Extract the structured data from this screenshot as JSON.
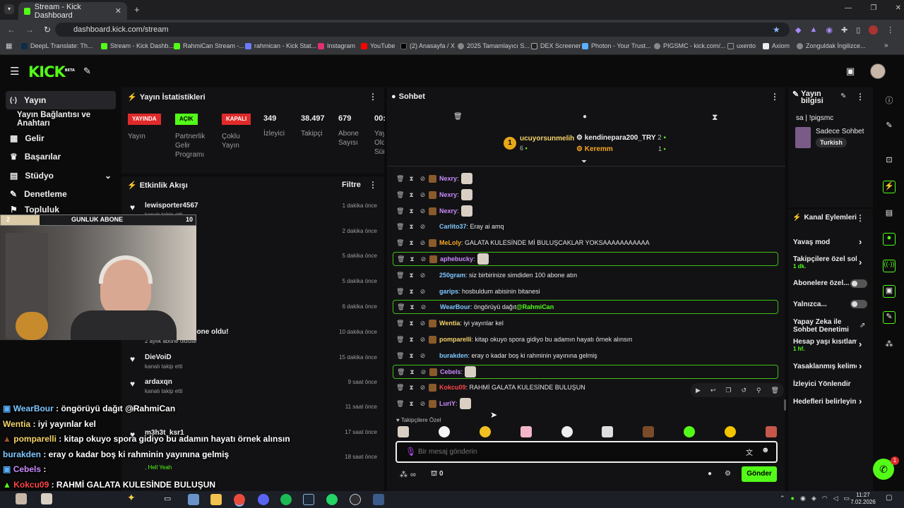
{
  "browser": {
    "tab_title": "Stream - Kick Dashboard",
    "url": "dashboard.kick.com/stream",
    "bookmarks": [
      "DeepL Translate: Th...",
      "Stream - Kick Dashb...",
      "RahmiCan Stream -...",
      "rahmican - Kick Stat...",
      "Instagram",
      "YouTube",
      "(2) Anasayfa / X",
      "2025 Tamamlayıcı S...",
      "DEX Screener",
      "Photon - Your Trust...",
      "PIGSMC - kick.com/...",
      "uxento",
      "Axiom",
      "Zonguldak İngilizce..."
    ]
  },
  "brand": {
    "logo": "KICK",
    "beta": "BETA",
    "accent": "#53fc18"
  },
  "nav": {
    "items": [
      "Yayın",
      "Yayın Bağlantısı ve Anahtarı",
      "Gelir",
      "Başarılar",
      "Stüdyo",
      "Denetleme",
      "Topluluk"
    ]
  },
  "stats": {
    "title": "Yayın İstatistikleri",
    "live_badge": "YAYINDA",
    "live_label": "Yayın",
    "partner_badge": "AÇIK",
    "partner_label": [
      "Partnerlik",
      "Gelir",
      "Programı"
    ],
    "multi_badge": "KAPALI",
    "multi_label": [
      "Çoklu",
      "Yayın"
    ],
    "viewers": "349",
    "viewers_label": "İzleyici",
    "followers": "38.497",
    "followers_label": "Takipçi",
    "subs": "679",
    "subs_label": [
      "Abone",
      "Sayısı"
    ],
    "uptime": "00:",
    "uptime_label": [
      "Yay",
      "Old",
      "Sür"
    ]
  },
  "activity": {
    "title": "Etkinlik Akışı",
    "filter": "Filtre",
    "items": [
      {
        "name": "lewisporter4567",
        "sub": "kanalı takip etti",
        "time": "1 dakika önce"
      },
      {
        "name": "",
        "sub": "",
        "time": "2 dakika önce"
      },
      {
        "name": "",
        "sub": "",
        "time": "5 dakika önce"
      },
      {
        "name": "",
        "sub": "",
        "time": "5 dakika önce"
      },
      {
        "name": "",
        "sub": "",
        "time": "6 dakika önce"
      },
      {
        "name": "n abone oldu!",
        "sub": "2 aylık abone oldular",
        "time": "10 dakika önce"
      },
      {
        "name": "DieVoiD",
        "sub": "kanalı takip etti",
        "time": "15 dakika önce"
      },
      {
        "name": "ardaxqn",
        "sub": "kanalı takip etti",
        "time": "9 saat önce"
      },
      {
        "name": "",
        "sub": "",
        "time": "11 saat önce"
      },
      {
        "name": "m3h3t_ksr1",
        "sub": "",
        "time": "17 saat önce"
      },
      {
        "name": "",
        "sub": ", Hell Yeah",
        "time": "18 saat önce"
      }
    ]
  },
  "overlay": {
    "goal_label": "GUNLUK ABONE",
    "goal_current": "2",
    "goal_target": "10",
    "goal_progress": 0.2,
    "chat": [
      {
        "user": "WearBour",
        "msg": " : öngörüyü dağıt @RahmiCan",
        "color": "#7ec8ff"
      },
      {
        "user": "Wentia",
        "msg": " : iyi yayınlar kel",
        "color": "#f5d36b"
      },
      {
        "user": "pomparelli",
        "msg": " : kitap okuyo spora gidiyo bu adamın hayatı örnek alınsın",
        "color": "#f5d36b"
      },
      {
        "user": "burakden",
        "msg": " : eray o kadar boş ki rahminin yayınına gelmiş",
        "color": "#7ec8ff"
      },
      {
        "user": "Cebels",
        "msg": " :",
        "color": "#c98bff"
      },
      {
        "user": "Kokcu09",
        "msg": " : RAHMİ GALATA KULESİNDE BULUŞUN",
        "color": "#ff4646"
      }
    ]
  },
  "chat": {
    "title": "Sohbet",
    "top_gifters": [
      {
        "name": "ucuyorsunmelih",
        "count": "6"
      },
      {
        "name": "kendinepara200_TRY",
        "count": "2"
      },
      {
        "name": "Keremm",
        "count": "1"
      }
    ],
    "rank": "1",
    "messages": [
      {
        "user": "Nexry",
        "msg": ":",
        "color": "#c98bff",
        "emote": true,
        "hl": false
      },
      {
        "user": "Nexry",
        "msg": ":",
        "color": "#c98bff",
        "emote": true,
        "hl": false
      },
      {
        "user": "Nexry",
        "msg": ":",
        "color": "#c98bff",
        "emote": true,
        "hl": false
      },
      {
        "user": "Carlito37",
        "msg": ": Eray ai amq",
        "color": "#7ec8ff",
        "emote": false,
        "hl": false
      },
      {
        "user": "MeLoly",
        "msg": ": GALATA KULESİNDE Mİ BULUŞCAKLAR YOKSAAAAAAAAAAA",
        "color": "#f5a623",
        "emote": false,
        "hl": false
      },
      {
        "user": "aphebucky",
        "msg": ":",
        "color": "#c98bff",
        "emote": true,
        "hl": true
      },
      {
        "user": "250gram",
        "msg": ": siz birbirinize simdiden 100 abone atın",
        "color": "#7ec8ff",
        "emote": false,
        "hl": false
      },
      {
        "user": "garips",
        "msg": ": hosbuldum abisinin bitanesi",
        "color": "#7ec8ff",
        "emote": false,
        "hl": false
      },
      {
        "user": "WearBour",
        "msg": ": öngörüyü dağıt ",
        "mention": "@RahmiCan",
        "color": "#7ec8ff",
        "emote": false,
        "hl": true
      },
      {
        "user": "Wentia",
        "msg": ": iyi yayınlar kel",
        "color": "#f5d36b",
        "emote": false,
        "hl": false
      },
      {
        "user": "pomparelli",
        "msg": ": kitap okuyo spora gidiyo bu adamın hayatı örnek alınsın",
        "color": "#f5d36b",
        "emote": false,
        "hl": false
      },
      {
        "user": "burakden",
        "msg": ": eray o kadar boş ki rahminin yayınına gelmiş",
        "color": "#7ec8ff",
        "emote": false,
        "hl": false
      },
      {
        "user": "Cebels",
        "msg": ":",
        "color": "#c98bff",
        "emote": true,
        "hl": true
      },
      {
        "user": "Kokcu09",
        "msg": ": RAHMİ GALATA KULESİNDE BULUŞUN",
        "color": "#ff4646",
        "emote": false,
        "hl": false
      },
      {
        "user": "LuriY",
        "msg": ":",
        "color": "#c98bff",
        "emote": true,
        "hl": false
      }
    ],
    "followers_only": "Takipçilere Özel",
    "input_placeholder": "Bir mesaj gönderin",
    "points": "0",
    "send": "Gönder"
  },
  "stream_info": {
    "title": [
      "Yayın",
      "bilgisi"
    ],
    "stream_title": "sa | !pigsmc",
    "category": "Sadece Sohbet",
    "tag": "Turkish"
  },
  "channel_actions": {
    "title": "Kanal Eylemleri",
    "items": [
      {
        "label": "Yavaş mod",
        "sub": "",
        "control": "chevron"
      },
      {
        "label": "Takipçilere özel soh",
        "sub": "1 dk.",
        "control": "chevron"
      },
      {
        "label": "Abonelere özel...",
        "sub": "",
        "control": "toggle"
      },
      {
        "label": "Yalnızca...",
        "sub": "",
        "control": "toggle"
      },
      {
        "label": "Yapay Zeka ile Sohbet Denetimi",
        "sub": "",
        "control": "external"
      },
      {
        "label": "Hesap yaşı kısıtlama",
        "sub": "1 hf.",
        "control": "chevron"
      },
      {
        "label": "Yasaklanmış kelime",
        "sub": "",
        "control": "chevron"
      },
      {
        "label": "İzleyici Yönlendir",
        "sub": "",
        "control": ""
      },
      {
        "label": "Hedefleri belirleyin",
        "sub": "",
        "control": "chevron"
      }
    ]
  },
  "notification_count": "1",
  "system": {
    "time": "11:27",
    "date": "7.02.2026"
  }
}
